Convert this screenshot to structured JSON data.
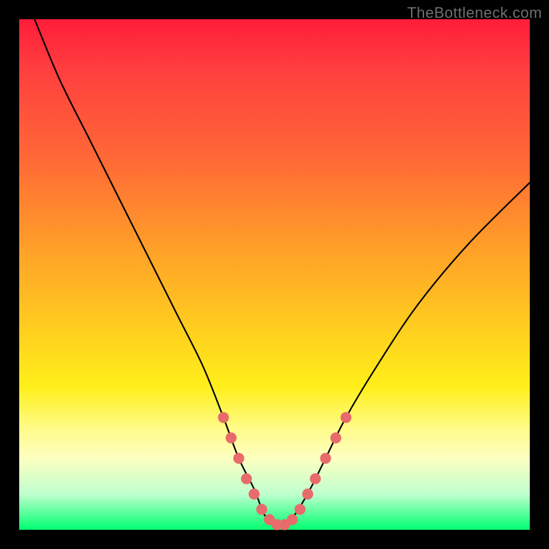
{
  "watermark": "TheBottleneck.com",
  "colors": {
    "frame": "#000000",
    "gradient_top": "#ff1d3a",
    "gradient_bottom": "#00ff70",
    "curve": "#000000",
    "marker": "#e86b6b"
  },
  "chart_data": {
    "type": "line",
    "title": "",
    "xlabel": "",
    "ylabel": "",
    "xlim": [
      0,
      100
    ],
    "ylim": [
      0,
      100
    ],
    "series": [
      {
        "name": "bottleneck-curve",
        "x": [
          3,
          8,
          14,
          20,
          26,
          31,
          36,
          40,
          43,
          46,
          48,
          50,
          52,
          54,
          57,
          60,
          64,
          70,
          78,
          88,
          100
        ],
        "y": [
          100,
          88,
          76,
          64,
          52,
          42,
          32,
          22,
          14,
          8,
          3,
          1,
          1,
          3,
          8,
          14,
          22,
          32,
          44,
          56,
          68
        ]
      }
    ],
    "markers": {
      "name": "highlight-points",
      "x": [
        40,
        41.5,
        43,
        44.5,
        46,
        47.5,
        49,
        50.5,
        52,
        53.5,
        55,
        56.5,
        58,
        60,
        62,
        64
      ],
      "y": [
        22,
        18,
        14,
        10,
        7,
        4,
        2,
        1,
        1,
        2,
        4,
        7,
        10,
        14,
        18,
        22
      ]
    }
  }
}
